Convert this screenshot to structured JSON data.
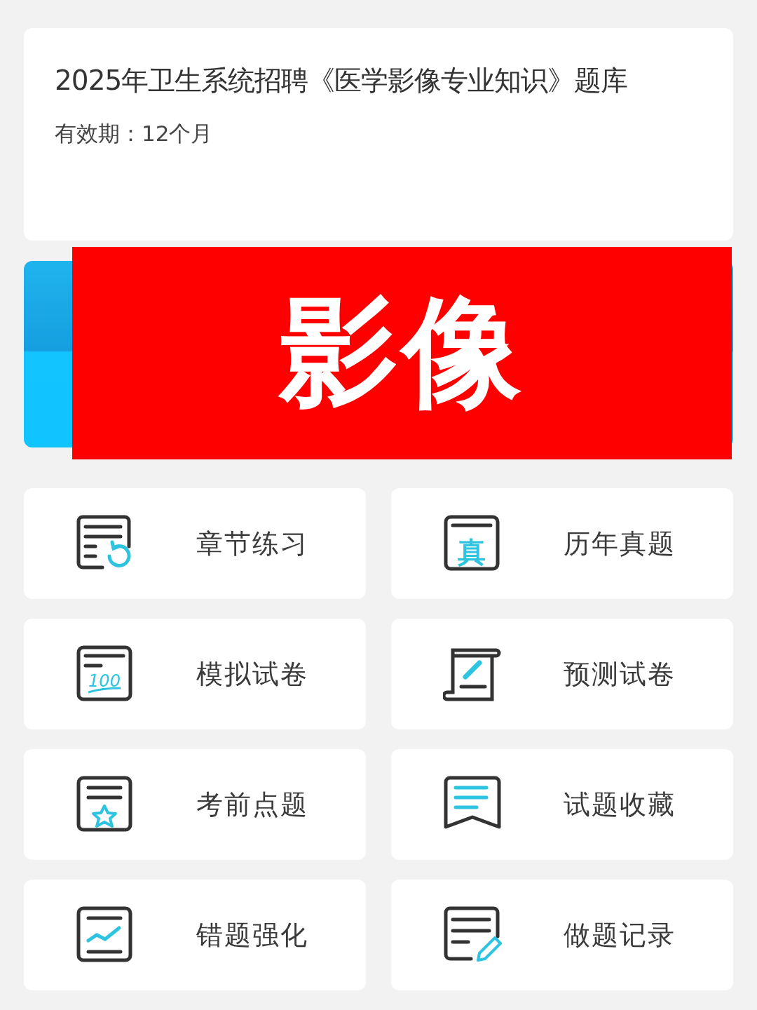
{
  "header": {
    "title": "2025年卫生系统招聘《医学影像专业知识》题库",
    "validity": "有效期：12个月"
  },
  "banner": {
    "label": "影像"
  },
  "menu": [
    {
      "label": "章节练习",
      "kind": "chapter"
    },
    {
      "label": "历年真题",
      "kind": "past",
      "icon_text": "真"
    },
    {
      "label": "模拟试卷",
      "kind": "mock",
      "icon_text": "100"
    },
    {
      "label": "预测试卷",
      "kind": "forecast"
    },
    {
      "label": "考前点题",
      "kind": "key"
    },
    {
      "label": "试题收藏",
      "kind": "favorite"
    },
    {
      "label": "错题强化",
      "kind": "mistake"
    },
    {
      "label": "做题记录",
      "kind": "record"
    }
  ]
}
